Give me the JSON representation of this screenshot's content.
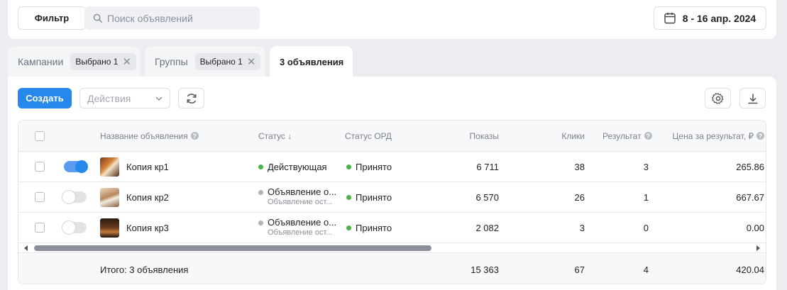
{
  "toolbar": {
    "filter_label": "Фильтр",
    "search_placeholder": "Поиск объявлений",
    "date_range": "8 - 16 апр. 2024"
  },
  "tabs": [
    {
      "label": "Кампании",
      "chip": "Выбрано 1"
    },
    {
      "label": "Группы",
      "chip": "Выбрано 1"
    },
    {
      "label": "3 объявления"
    }
  ],
  "actions": {
    "create_label": "Создать",
    "actions_placeholder": "Действия"
  },
  "table": {
    "columns": {
      "name": "Название объявления",
      "status": "Статус ↓",
      "ord": "Статус ОРД",
      "shows": "Показы",
      "clicks": "Клики",
      "result": "Результат",
      "price": "Цена за результат, ₽"
    },
    "rows": [
      {
        "name": "Копия кр1",
        "enabled": true,
        "status": "Действующая",
        "status_color": "#4bb34b",
        "status_sub": "",
        "ord": "Принято",
        "shows": "6 711",
        "clicks": "38",
        "result": "3",
        "price": "265.86"
      },
      {
        "name": "Копия кр2",
        "enabled": false,
        "status": "Объявление о...",
        "status_color": "#aeb3ba",
        "status_sub": "Объявление ост...",
        "ord": "Принято",
        "shows": "6 570",
        "clicks": "26",
        "result": "1",
        "price": "667.67"
      },
      {
        "name": "Копия кр3",
        "enabled": false,
        "status": "Объявление о...",
        "status_color": "#aeb3ba",
        "status_sub": "Объявление ост...",
        "ord": "Принято",
        "shows": "2 082",
        "clicks": "3",
        "result": "0",
        "price": "0.00"
      }
    ],
    "footer": {
      "label": "Итого: 3 объявления",
      "shows": "15 363",
      "clicks": "67",
      "result": "4",
      "price": "420.04"
    }
  },
  "colors": {
    "accent": "#2688eb",
    "success": "#4bb34b"
  }
}
